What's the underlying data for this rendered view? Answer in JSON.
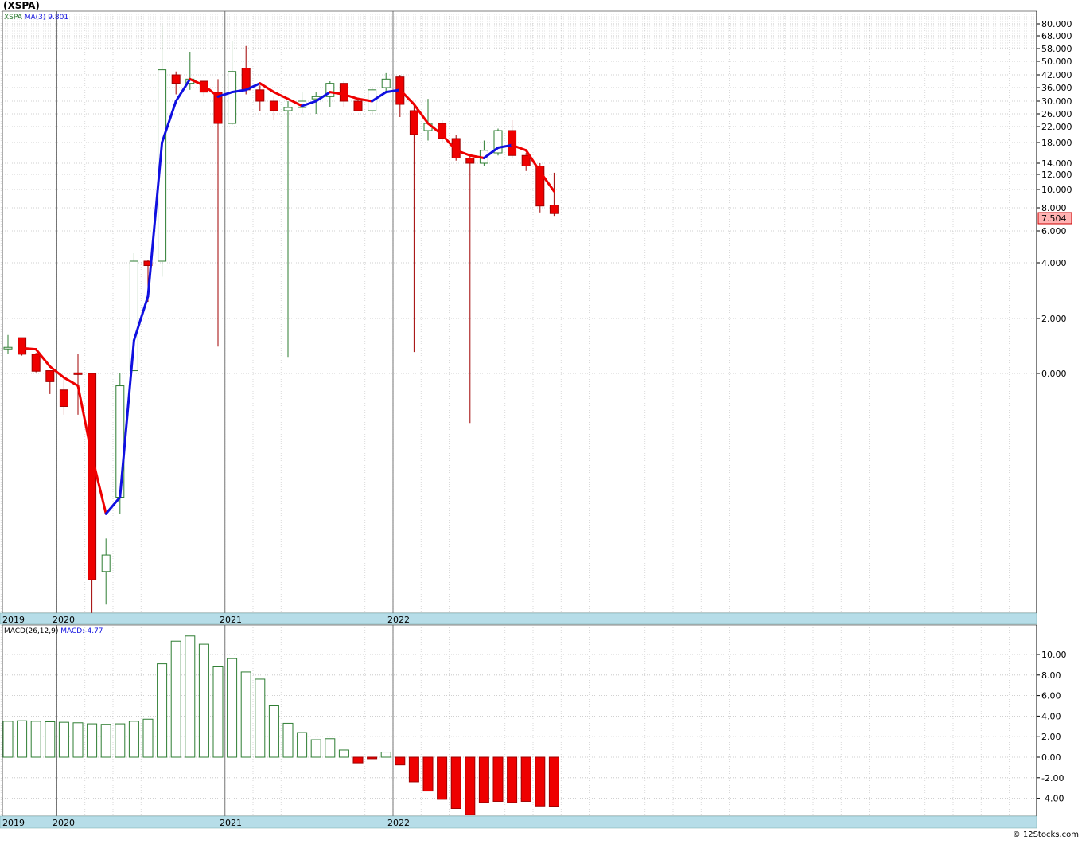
{
  "title": "(XSPA)",
  "copyright": "© 12Stocks.com",
  "colors": {
    "background": "#ffffff",
    "grid": "#c0c0c0",
    "axis_band": "#b6dde8",
    "up_body_fill": "#ffffff",
    "up_body_stroke": "#2e7d32",
    "down_body": "#ee0000",
    "ma_up": "#1010e0",
    "ma_down": "#ee0000",
    "last_price_bg": "#ffb3b3",
    "legend_symbol": "#2e7d32",
    "legend_ma": "#1010e0"
  },
  "chart_data": [
    {
      "type": "candlestick",
      "panel": "price",
      "legend": {
        "symbol": "XSPA",
        "ma_label": "MA(3)",
        "ma_value": "9.801"
      },
      "y_tick_labels": [
        "80.000",
        "68.000",
        "58.000",
        "50.000",
        "42.000",
        "36.000",
        "30.000",
        "26.000",
        "22.000",
        "18.000",
        "14.000",
        "12.000",
        "10.000",
        "8.000",
        "6.000",
        "4.000",
        "2.000",
        "0.000"
      ],
      "last_price": "7.504",
      "x_labels": [
        "2019",
        "2020",
        "2021",
        "2022"
      ],
      "candles": [
        {
          "o": 0.9,
          "h": 1.4,
          "l": 0.7,
          "c": 0.95
        },
        {
          "o": 1.3,
          "h": 1.3,
          "l": 0.65,
          "c": 0.7
        },
        {
          "o": 0.7,
          "h": 0.75,
          "l": 0.04,
          "c": 0.08
        },
        {
          "o": 0.1,
          "h": 0.05,
          "l": -0.05,
          "c": -0.02
        },
        {
          "o": -0.04,
          "h": -0.01,
          "l": -0.1,
          "c": -0.08
        },
        {
          "o": 0.02,
          "h": 0.7,
          "l": -0.1,
          "c": 0.0
        },
        {
          "o": 0.0,
          "h": 0.01,
          "l": -0.6,
          "c": -0.5
        },
        {
          "o": -0.48,
          "h": -0.4,
          "l": -0.56,
          "c": -0.44
        },
        {
          "o": -0.3,
          "h": 0.0,
          "l": -0.34,
          "c": -0.03
        },
        {
          "o": 0.1,
          "h": 4.6,
          "l": 0.08,
          "c": 4.1
        },
        {
          "o": 4.1,
          "h": 4.2,
          "l": 2.6,
          "c": 3.9
        },
        {
          "o": 4.1,
          "h": 78.0,
          "l": 3.5,
          "c": 45.0
        },
        {
          "o": 42.0,
          "h": 44.0,
          "l": 33.0,
          "c": 38.0
        },
        {
          "o": 38.0,
          "h": 56.0,
          "l": 35.0,
          "c": 40.0
        },
        {
          "o": 39.0,
          "h": 39.0,
          "l": 32.0,
          "c": 34.0
        },
        {
          "o": 34.0,
          "h": 40.0,
          "l": 0.98,
          "c": 23.0
        },
        {
          "o": 23.0,
          "h": 64.0,
          "l": 22.5,
          "c": 44.0
        },
        {
          "o": 46.0,
          "h": 60.0,
          "l": 33.0,
          "c": 35.0
        },
        {
          "o": 35.0,
          "h": 37.0,
          "l": 27.0,
          "c": 30.0
        },
        {
          "o": 30.0,
          "h": 32.0,
          "l": 24.0,
          "c": 27.0
        },
        {
          "o": 27.0,
          "h": 30.0,
          "l": 0.6,
          "c": 28.0
        },
        {
          "o": 28.0,
          "h": 34.0,
          "l": 26.0,
          "c": 30.0
        },
        {
          "o": 31.0,
          "h": 34.0,
          "l": 26.0,
          "c": 32.0
        },
        {
          "o": 32.0,
          "h": 39.0,
          "l": 28.0,
          "c": 38.0
        },
        {
          "o": 38.0,
          "h": 39.0,
          "l": 28.0,
          "c": 30.0
        },
        {
          "o": 30.0,
          "h": 31.0,
          "l": 27.0,
          "c": 27.0
        },
        {
          "o": 27.0,
          "h": 36.0,
          "l": 26.0,
          "c": 35.0
        },
        {
          "o": 36.0,
          "h": 43.0,
          "l": 34.0,
          "c": 40.0
        },
        {
          "o": 41.0,
          "h": 42.0,
          "l": 25.0,
          "c": 29.0
        },
        {
          "o": 27.0,
          "h": 29.0,
          "l": 0.78,
          "c": 20.0
        },
        {
          "o": 21.0,
          "h": 31.0,
          "l": 18.5,
          "c": 23.0
        },
        {
          "o": 23.0,
          "h": 24.0,
          "l": 18.0,
          "c": 19.0
        },
        {
          "o": 19.0,
          "h": 20.0,
          "l": 14.5,
          "c": 15.0
        },
        {
          "o": 15.0,
          "h": 15.5,
          "l": -0.12,
          "c": 14.0
        },
        {
          "o": 14.0,
          "h": 18.5,
          "l": 13.5,
          "c": 16.5
        },
        {
          "o": 16.0,
          "h": 21.5,
          "l": 15.5,
          "c": 21.0
        },
        {
          "o": 21.0,
          "h": 24.0,
          "l": 15.0,
          "c": 15.5
        },
        {
          "o": 15.5,
          "h": 16.0,
          "l": 12.6,
          "c": 13.5
        },
        {
          "o": 13.5,
          "h": 14.0,
          "l": 7.6,
          "c": 8.2
        },
        {
          "o": 8.3,
          "h": 12.3,
          "l": 7.3,
          "c": 7.504
        }
      ],
      "ma": [
        null,
        0.92,
        0.88,
        0.25,
        -0.01,
        -0.03,
        -0.2,
        -0.34,
        -0.3,
        1.2,
        2.8,
        18.0,
        30.0,
        40.0,
        37.0,
        32.0,
        34.0,
        35.0,
        38.0,
        34.0,
        31.0,
        28.5,
        30.0,
        34.0,
        33.0,
        31.0,
        30.0,
        34.0,
        35.0,
        29.0,
        23.0,
        20.0,
        16.5,
        15.5,
        15.0,
        17.0,
        17.5,
        16.5,
        12.5,
        9.801
      ]
    },
    {
      "type": "bar",
      "panel": "macd",
      "legend": {
        "label": "MACD(26,12,9)",
        "value_label": "MACD:-4.77"
      },
      "y_tick_labels": [
        "10.00",
        "8.00",
        "6.00",
        "4.00",
        "2.00",
        "0.00",
        "-2.00",
        "-4.00"
      ],
      "ylim": [
        -5.7,
        11.8
      ],
      "x_labels": [
        "2019",
        "2020",
        "2021",
        "2022"
      ],
      "values": [
        3.5,
        3.55,
        3.5,
        3.45,
        3.4,
        3.35,
        3.25,
        3.2,
        3.25,
        3.5,
        3.7,
        9.1,
        11.3,
        11.8,
        11.0,
        8.8,
        9.6,
        8.3,
        7.6,
        5.0,
        3.3,
        2.4,
        1.7,
        1.8,
        0.7,
        -0.55,
        -0.15,
        0.5,
        -0.75,
        -2.4,
        -3.3,
        -4.1,
        -5.0,
        -5.6,
        -4.4,
        -4.3,
        -4.4,
        -4.3,
        -4.75,
        -4.77
      ]
    }
  ]
}
